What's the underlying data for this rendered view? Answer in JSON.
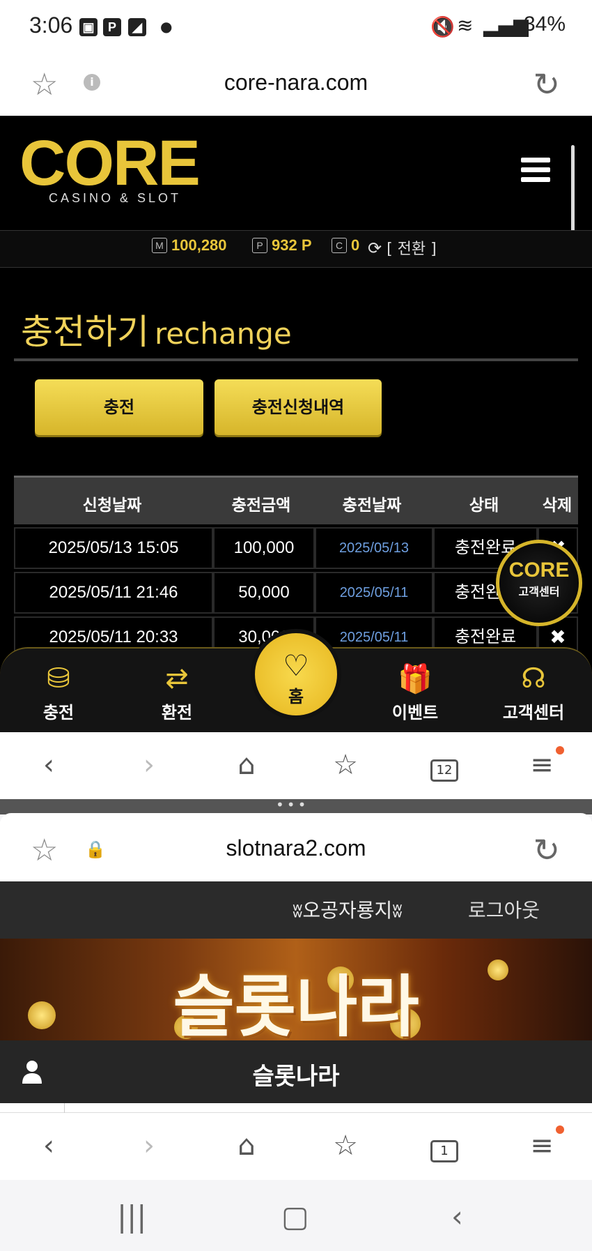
{
  "status_bar": {
    "time": "3:06",
    "battery": "34%",
    "icons": [
      "image-icon",
      "p-icon",
      "note-icon"
    ]
  },
  "browser_top": {
    "url": "core-nara.com"
  },
  "core_site": {
    "logo": "CORE",
    "logo_sub": "CASINO & SLOT",
    "balance": {
      "m_tag": "M",
      "m_value": "100,280",
      "p_tag": "P",
      "p_value": "932 P",
      "c_tag": "C",
      "c_value": "0",
      "switch_label": "[ 전환 ]"
    },
    "page_title_ko": "충전하기",
    "page_title_en": "rechange",
    "buttons": {
      "charge": "충전",
      "history": "충전신청내역"
    },
    "table": {
      "headers": [
        "신청날짜",
        "충전금액",
        "충전날짜",
        "상태",
        "삭제"
      ],
      "rows": [
        {
          "requested": "2025/05/13 15:05",
          "amount": "100,000",
          "charged": "2025/05/13",
          "status": "충전완료"
        },
        {
          "requested": "2025/05/11 21:46",
          "amount": "50,000",
          "charged": "2025/05/11",
          "status": "충전완료"
        },
        {
          "requested": "2025/05/11 20:33",
          "amount": "30,000",
          "charged": "2025/05/11",
          "status": "충전완료"
        }
      ]
    },
    "cs_float": {
      "logo": "CORE",
      "label": "고객센터"
    },
    "bottom_nav": {
      "charge": "충전",
      "exchange": "환전",
      "home": "홈",
      "event": "이벤트",
      "cs": "고객센터"
    }
  },
  "browser_toolbar_1": {
    "tab_count": "12"
  },
  "browser_top_2": {
    "url": "slotnara2.com"
  },
  "slot_site": {
    "user": "ʬ오공자룡지ʬ",
    "logout": "로그아웃",
    "banner_title": "슬롯나라",
    "name": "슬롯나라"
  },
  "browser_toolbar_2": {
    "tab_count": "1"
  }
}
